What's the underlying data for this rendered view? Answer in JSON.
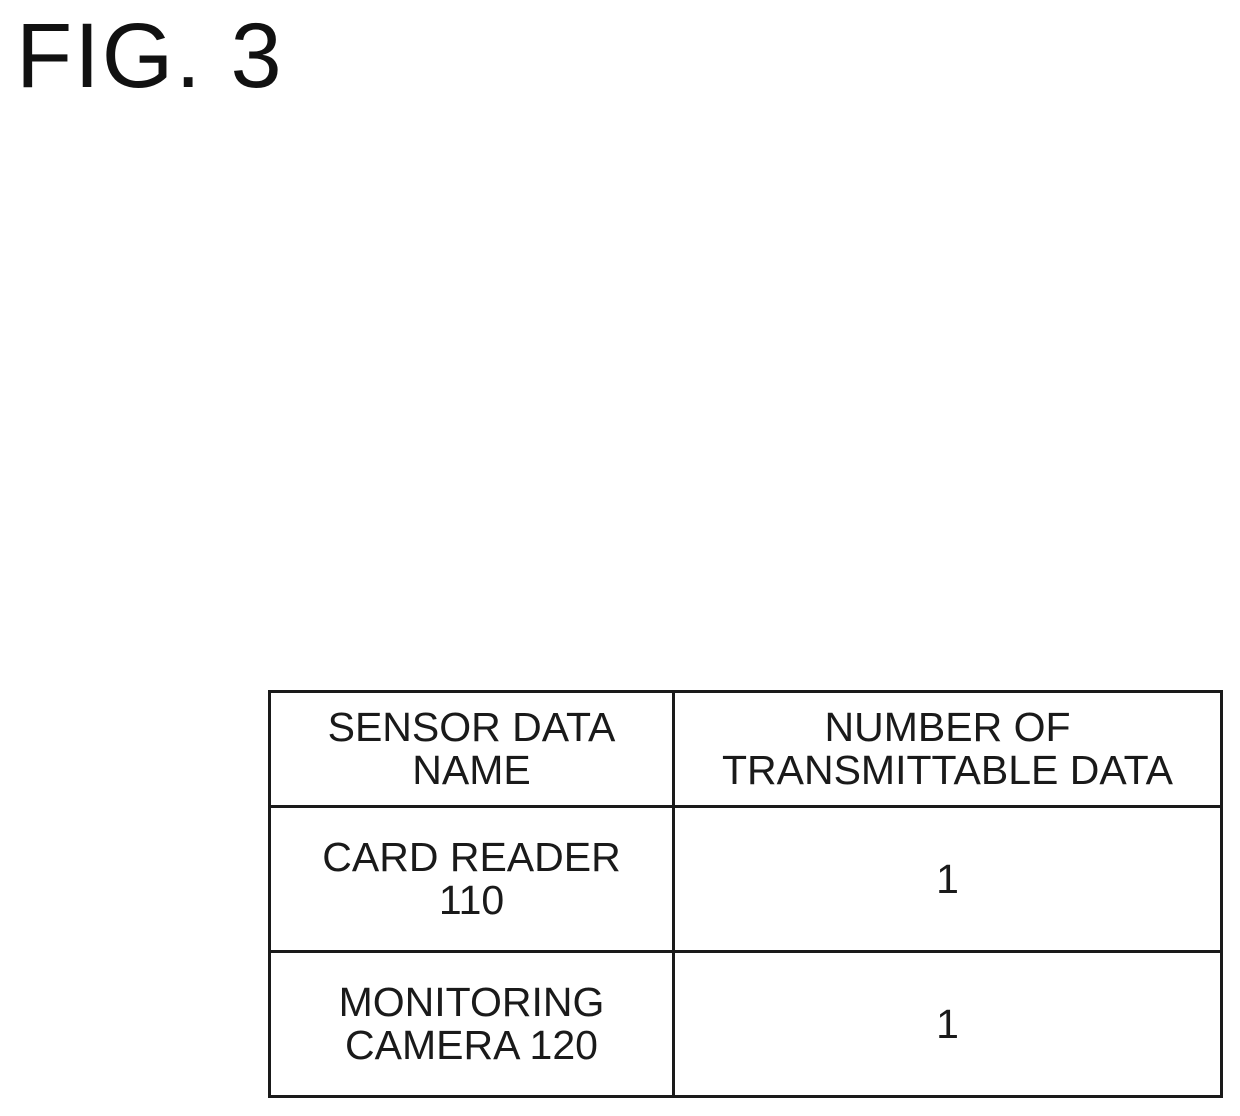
{
  "figure": {
    "title": "FIG. 3"
  },
  "table": {
    "headers": [
      {
        "lines": [
          "SENSOR DATA",
          "NAME"
        ]
      },
      {
        "lines": [
          "NUMBER OF",
          "TRANSMITTABLE DATA"
        ]
      }
    ],
    "rows": [
      {
        "sensor_name_lines": [
          "CARD READER",
          "110"
        ],
        "transmittable": "1"
      },
      {
        "sensor_name_lines": [
          "MONITORING",
          "CAMERA 120"
        ],
        "transmittable": "1"
      }
    ]
  }
}
